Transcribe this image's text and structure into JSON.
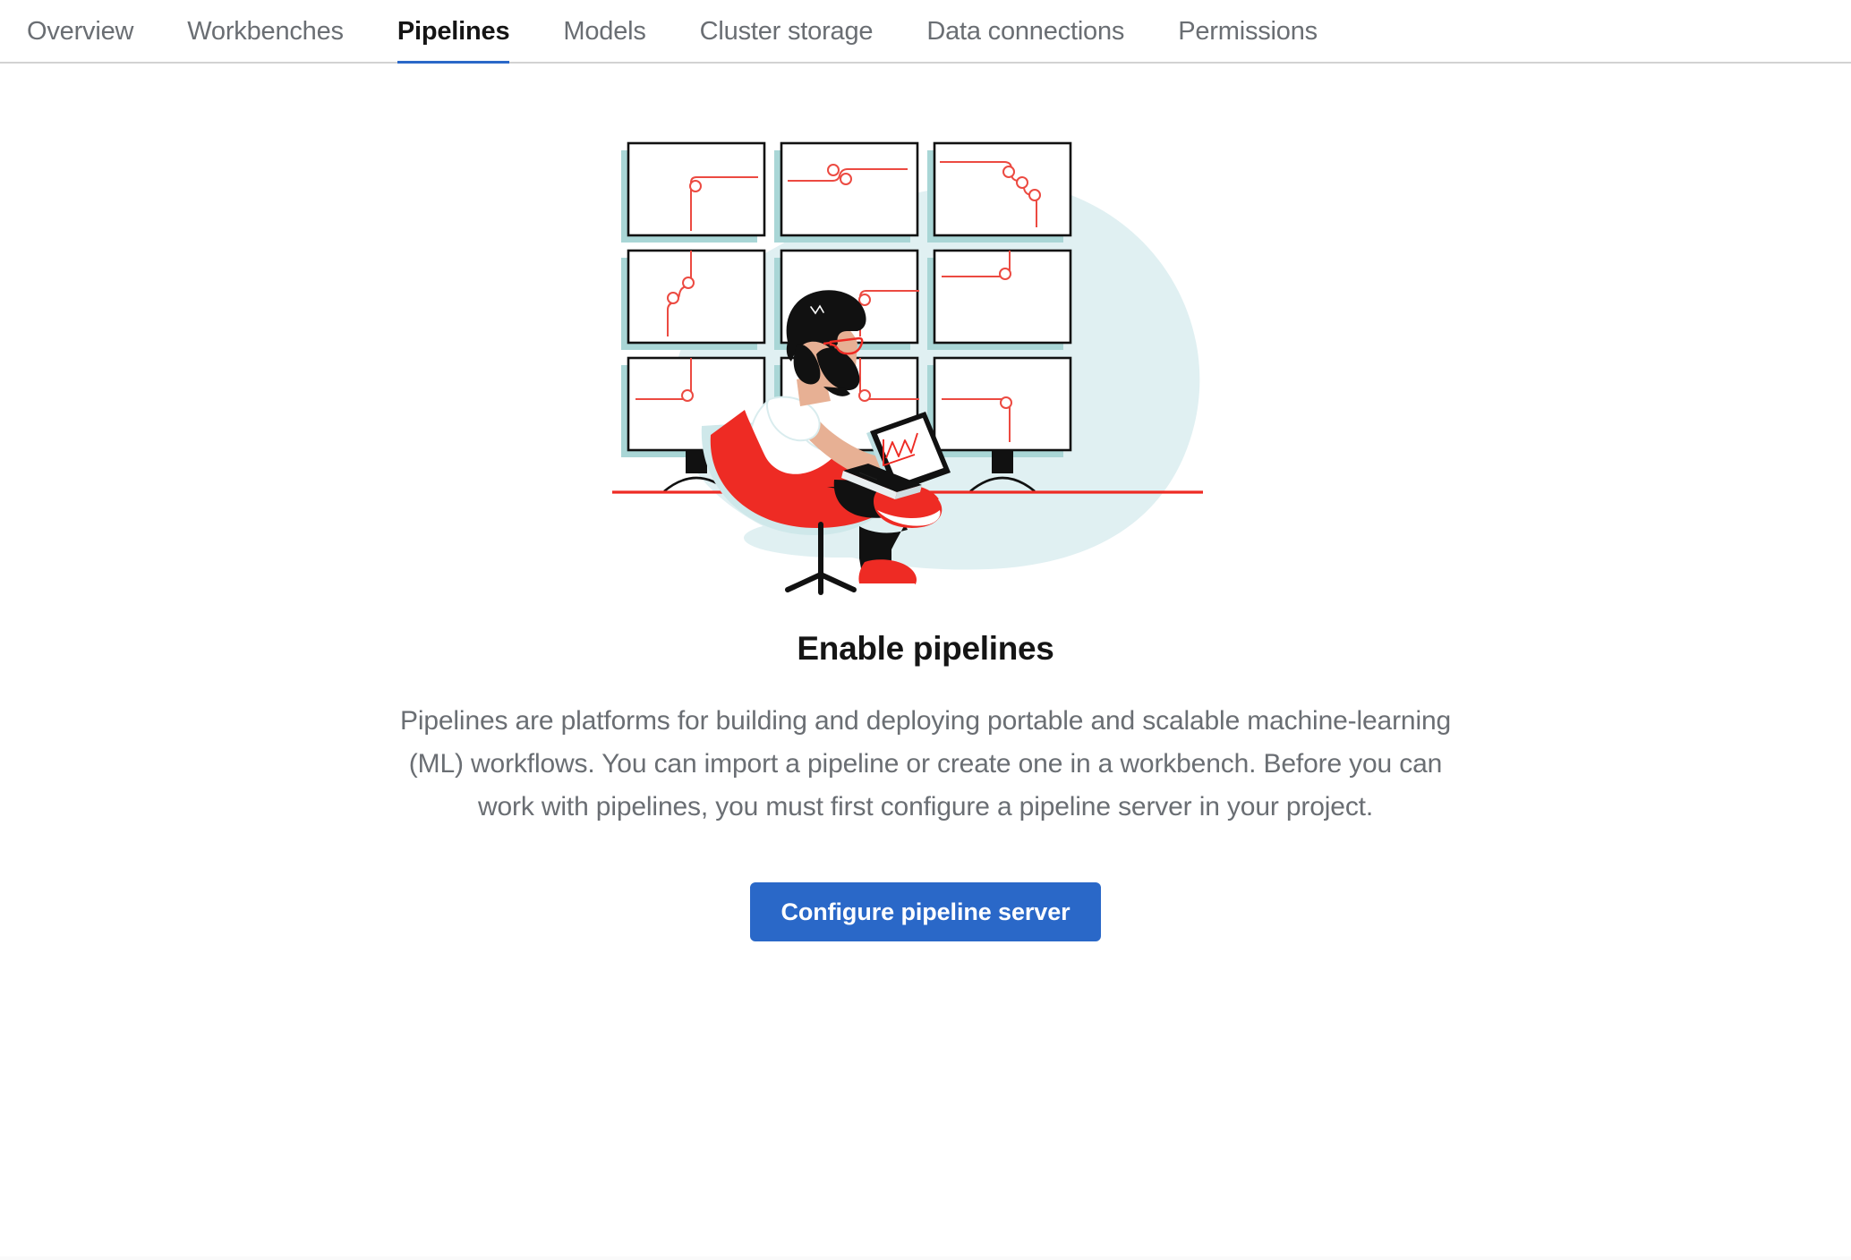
{
  "tabs": [
    {
      "label": "Overview",
      "active": false
    },
    {
      "label": "Workbenches",
      "active": false
    },
    {
      "label": "Pipelines",
      "active": true
    },
    {
      "label": "Models",
      "active": false
    },
    {
      "label": "Cluster storage",
      "active": false
    },
    {
      "label": "Data connections",
      "active": false
    },
    {
      "label": "Permissions",
      "active": false
    }
  ],
  "empty_state": {
    "illustration_name": "person-at-monitor-wall-illustration",
    "title": "Enable pipelines",
    "body": "Pipelines are platforms for building and deploying portable and scalable machine-learning (ML) workflows. You can import a pipeline or create one in a workbench. Before you can work with pipelines, you must first configure a pipeline server in your project.",
    "primary_action": "Configure pipeline server"
  },
  "colors": {
    "accent_blue": "#2a68c8",
    "active_tab_text": "#151515",
    "inactive_tab_text": "#6a6e73",
    "body_text": "#6a6e73",
    "illustration_red": "#ee2b24",
    "illustration_red_line": "#ec4a41",
    "illustration_teal": "#a9d6d6",
    "illustration_pale_blue": "#e0f0f2",
    "illustration_skin": "#e7b094",
    "illustration_black": "#111111",
    "border_gray": "#d2d2d2"
  }
}
